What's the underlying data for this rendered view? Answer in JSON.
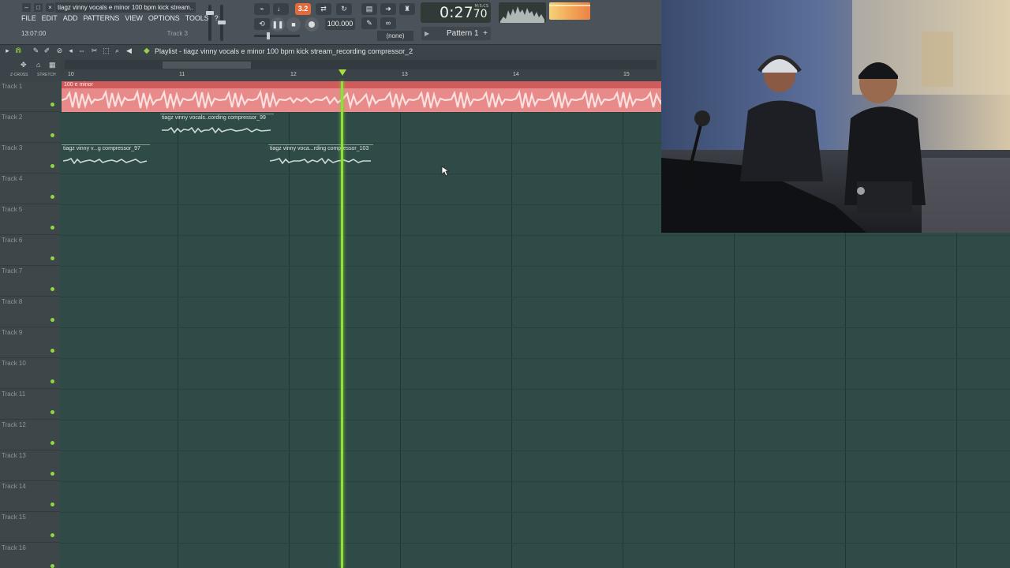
{
  "window": {
    "title": "tiagz vinny vocals e minor 100 bpm kick stream..",
    "controls": [
      "–",
      "□",
      "×"
    ]
  },
  "menu": [
    "FILE",
    "EDIT",
    "ADD",
    "PATTERNS",
    "VIEW",
    "OPTIONS",
    "TOOLS",
    "?"
  ],
  "hint": {
    "left": "13:07:00",
    "right": "Track 3"
  },
  "transport": {
    "mode_value": "3.2",
    "tempo": "100.000",
    "time": "0:27",
    "time_sub": "70",
    "time_units": "M:S:CS",
    "pattern_select": "(none)",
    "pattern": "Pattern 1"
  },
  "playlist": {
    "title": "Playlist - tiagz vinny vocals e minor 100 bpm kick stream_recording compressor_2",
    "header_options": [
      "Z-CROSS",
      "STRETCH"
    ],
    "ruler_marks": [
      "10",
      "11",
      "12",
      "13",
      "14",
      "15"
    ]
  },
  "tracks": [
    "Track 1",
    "Track 2",
    "Track 3",
    "Track 4",
    "Track 5",
    "Track 6",
    "Track 7",
    "Track 8",
    "Track 9",
    "Track 10",
    "Track 11",
    "Track 12",
    "Track 13",
    "Track 14",
    "Track 15",
    "Track 16"
  ],
  "clips": {
    "top": "100 e minor",
    "c1": "tiagz vinny vocals..cording compressor_99",
    "c2": "tiagz vinny v...g compressor_97",
    "c3": "tiagz vinny voca...rding compressor_103"
  },
  "colors": {
    "accent_green": "#8fe03a",
    "clip_red": "#e88a8a",
    "orange_button": "#e36a3c",
    "lane_bg": "#2f4b47"
  },
  "icons": [
    "magnet-icon",
    "pencil-icon",
    "paint-icon",
    "delete-icon",
    "mute-icon",
    "slice-icon",
    "select-icon",
    "zoom-icon",
    "playback-icon"
  ]
}
